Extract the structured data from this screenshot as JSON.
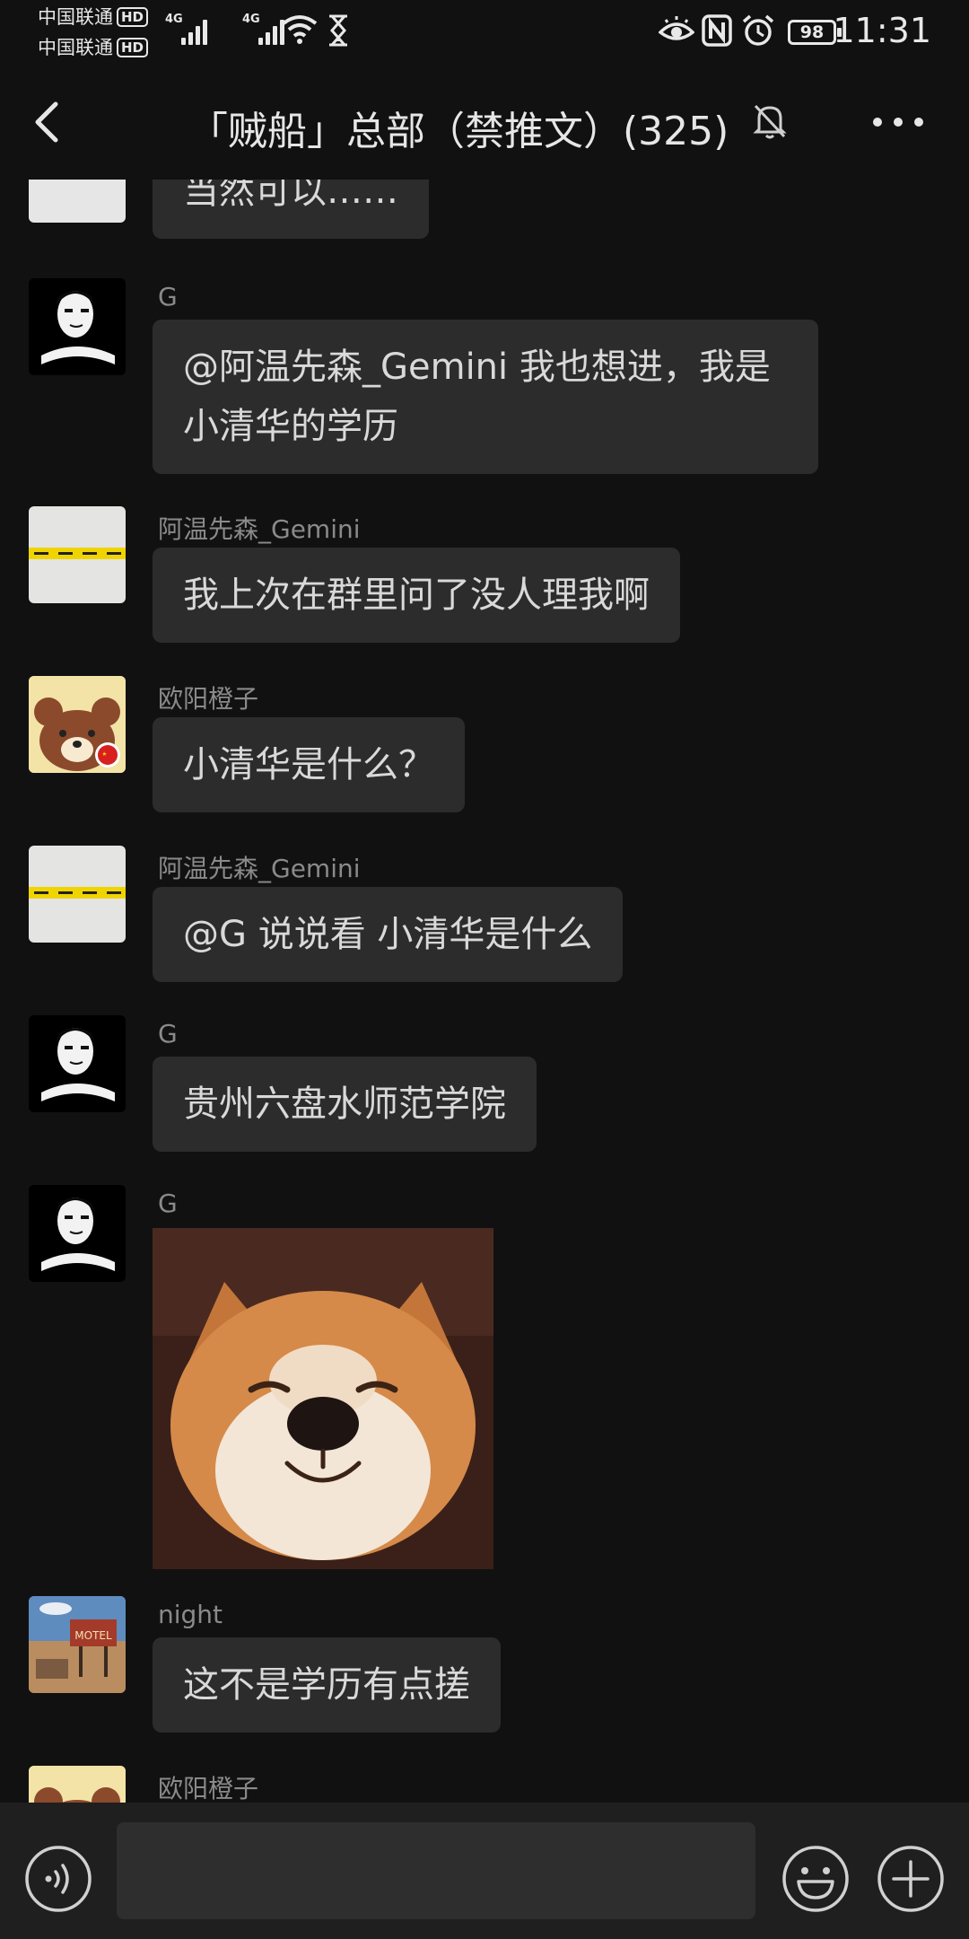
{
  "status_bar": {
    "carrier_1": "中国联通",
    "carrier_2": "中国联通",
    "hd_badge": "HD",
    "network_type": "4G",
    "battery_level": "98",
    "time": "11:31"
  },
  "header": {
    "title": "「贼船」总部（禁推文）(325)"
  },
  "messages": [
    {
      "sender": "",
      "text": "当然可以……",
      "avatar": "blank-avatar"
    },
    {
      "sender": "G",
      "text": "@阿温先森_Gemini 我也想进，我是小清华的学历",
      "avatar": "portrait-avatar"
    },
    {
      "sender": "阿温先森_Gemini",
      "text": "我上次在群里问了没人理我啊",
      "avatar": "tape-avatar"
    },
    {
      "sender": "欧阳橙子",
      "text": "小清华是什么？",
      "avatar": "bear-avatar"
    },
    {
      "sender": "阿温先森_Gemini",
      "text": "@G  说说看 小清华是什么",
      "avatar": "tape-avatar"
    },
    {
      "sender": "G",
      "text": "贵州六盘水师范学院",
      "avatar": "portrait-avatar"
    },
    {
      "sender": "G",
      "text": "",
      "avatar": "portrait-avatar",
      "sticker": "shiba-inu-sticker"
    },
    {
      "sender": "night",
      "text": "这不是学历有点搓",
      "avatar": "motel-avatar",
      "avatar_text": "MOTEL"
    },
    {
      "sender": "欧阳橙子",
      "text": "",
      "avatar": "bear-avatar"
    }
  ],
  "input_bar": {
    "placeholder": ""
  },
  "colors": {
    "background": "#111111",
    "bubble": "#2c2c2c",
    "input_bar": "#1f1f1f",
    "sender_name": "#8a8a8a",
    "tape_yellow": "#f0d400"
  }
}
